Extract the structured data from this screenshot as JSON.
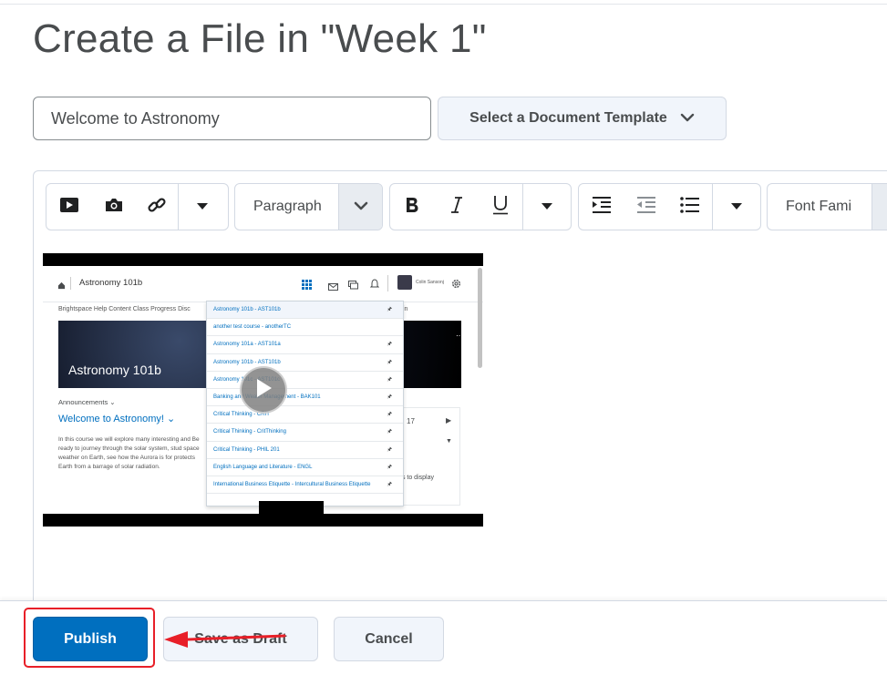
{
  "page": {
    "title": "Create a File in \"Week 1\""
  },
  "form": {
    "title_value": "Welcome to Astronomy",
    "template_label": "Select a Document Template"
  },
  "toolbar": {
    "paragraph_label": "Paragraph",
    "font_label": "Font Fami"
  },
  "embedded_video": {
    "course_name": "Astronomy 101b",
    "user_name": "Colin Sansonj",
    "menu_items": "Brightspace Help   Content   Class Progress   Disc",
    "menu_tail": "in",
    "hero_title": "Astronomy 101b",
    "announcements_label": "Announcements ⌄",
    "welcome_heading": "Welcome to Astronomy! ⌄",
    "body_text": "In this course we will explore many interesting and Be ready to journey through the solar system, stud space weather on Earth, see how the Aurora is for protects Earth from a barrage of solar radiation.",
    "calendar_day": "17",
    "right_card_text": "ts to display",
    "dropdown_items": [
      "Astronomy 101b - AST101b",
      "another test course - anotherTC",
      "Astronomy 101a - AST101a",
      "Astronomy 101b - AST101b",
      "Astronomy 101c - AST101c",
      "Banking and Wealth Management - BAK101",
      "Critical Thinking - CRIT",
      "Critical Thinking - CritThinking",
      "Critical Thinking - PHIL 201",
      "English Language and Literature - ENGL",
      "International Business Etiquette - Intercultural Business Etiquette"
    ]
  },
  "footer": {
    "publish_label": "Publish",
    "draft_label": "Save as Draft",
    "cancel_label": "Cancel"
  },
  "colors": {
    "primary": "#006fbf",
    "highlight": "#e81f28",
    "secondary_bg": "#f1f5fb"
  }
}
